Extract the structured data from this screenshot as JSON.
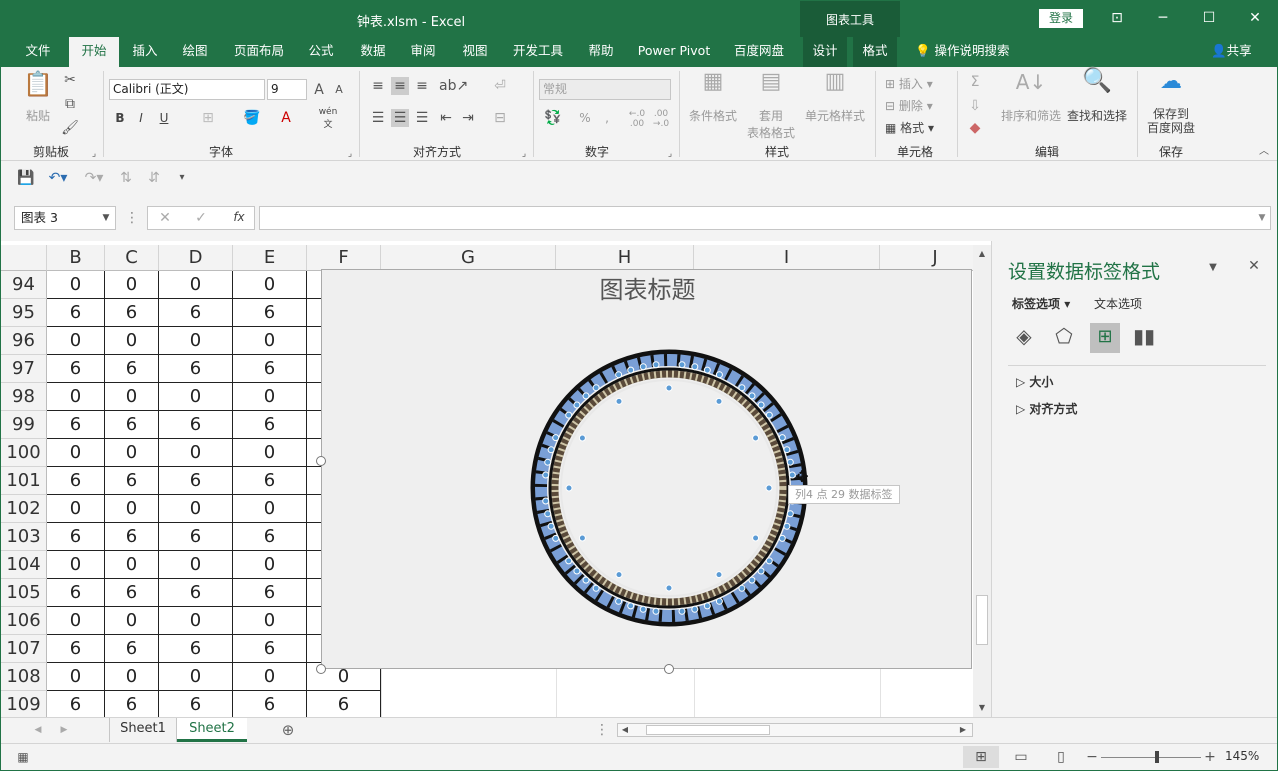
{
  "window": {
    "title": "钟表.xlsm  -  Excel",
    "context_tools": "图表工具",
    "login": "登录"
  },
  "tabs": [
    {
      "label": "文件"
    },
    {
      "label": "开始"
    },
    {
      "label": "插入"
    },
    {
      "label": "绘图"
    },
    {
      "label": "页面布局"
    },
    {
      "label": "公式"
    },
    {
      "label": "数据"
    },
    {
      "label": "审阅"
    },
    {
      "label": "视图"
    },
    {
      "label": "开发工具"
    },
    {
      "label": "帮助"
    },
    {
      "label": "Power Pivot"
    },
    {
      "label": "百度网盘"
    },
    {
      "label": "设计"
    },
    {
      "label": "格式"
    }
  ],
  "tellme": "操作说明搜索",
  "share": "共享",
  "ribbon": {
    "clipboard": {
      "label": "剪贴板",
      "paste": "粘贴"
    },
    "font": {
      "label": "字体",
      "name": "Calibri (正文)",
      "size": "9",
      "bold": "B",
      "italic": "I",
      "underline": "U",
      "wen": "wén",
      "wen2": "文"
    },
    "alignment": {
      "label": "对齐方式"
    },
    "number": {
      "label": "数字",
      "format": "常规",
      "percent": "%",
      "comma": ",",
      "inc": "←.0\n.00",
      "dec": ".00\n→.0"
    },
    "styles": {
      "label": "样式",
      "conditional": "条件格式",
      "table1": "套用",
      "table2": "表格格式",
      "cell": "单元格样式"
    },
    "cells": {
      "label": "单元格",
      "insert": "插入",
      "delete": "删除",
      "format": "格式"
    },
    "editing": {
      "label": "编辑",
      "sort": "排序和筛选",
      "find": "查找和选择"
    },
    "save": {
      "label": "保存",
      "btn1": "保存到",
      "btn2": "百度网盘"
    }
  },
  "formula_bar": {
    "name_box": "图表 3",
    "fx": "fx",
    "formula": ""
  },
  "columns": [
    {
      "label": "B"
    },
    {
      "label": "C"
    },
    {
      "label": "D"
    },
    {
      "label": "E"
    },
    {
      "label": "F"
    },
    {
      "label": "G"
    },
    {
      "label": "H"
    },
    {
      "label": "I"
    },
    {
      "label": "J"
    }
  ],
  "rows": [
    {
      "num": "94",
      "vals": [
        "0",
        "0",
        "0",
        "0"
      ]
    },
    {
      "num": "95",
      "vals": [
        "6",
        "6",
        "6",
        "6"
      ]
    },
    {
      "num": "96",
      "vals": [
        "0",
        "0",
        "0",
        "0"
      ]
    },
    {
      "num": "97",
      "vals": [
        "6",
        "6",
        "6",
        "6"
      ]
    },
    {
      "num": "98",
      "vals": [
        "0",
        "0",
        "0",
        "0"
      ]
    },
    {
      "num": "99",
      "vals": [
        "6",
        "6",
        "6",
        "6"
      ]
    },
    {
      "num": "100",
      "vals": [
        "0",
        "0",
        "0",
        "0"
      ]
    },
    {
      "num": "101",
      "vals": [
        "6",
        "6",
        "6",
        "6"
      ]
    },
    {
      "num": "102",
      "vals": [
        "0",
        "0",
        "0",
        "0"
      ]
    },
    {
      "num": "103",
      "vals": [
        "6",
        "6",
        "6",
        "6"
      ]
    },
    {
      "num": "104",
      "vals": [
        "0",
        "0",
        "0",
        "0"
      ]
    },
    {
      "num": "105",
      "vals": [
        "6",
        "6",
        "6",
        "6"
      ]
    },
    {
      "num": "106",
      "vals": [
        "0",
        "0",
        "0",
        "0"
      ]
    },
    {
      "num": "107",
      "vals": [
        "6",
        "6",
        "6",
        "6"
      ]
    },
    {
      "num": "108",
      "vals": [
        "0",
        "0",
        "0",
        "0"
      ],
      "f": "0"
    },
    {
      "num": "109",
      "vals": [
        "6",
        "6",
        "6",
        "6"
      ],
      "f": "6"
    }
  ],
  "chart": {
    "title": "图表标题",
    "tooltip": "列4 点 29 数据标签"
  },
  "pane": {
    "title": "设置数据标签格式",
    "tab_label": "标签选项",
    "tab_text": "文本选项",
    "section_size": "大小",
    "section_align": "对齐方式"
  },
  "sheets": [
    {
      "label": "Sheet1"
    },
    {
      "label": "Sheet2"
    }
  ],
  "status": {
    "zoom": "145%"
  },
  "colors": {
    "accent": "#217346",
    "ribbon_bg": "#f3f3f3",
    "ring_blue": "#7a9fd6",
    "ring_dark": "#111111"
  }
}
